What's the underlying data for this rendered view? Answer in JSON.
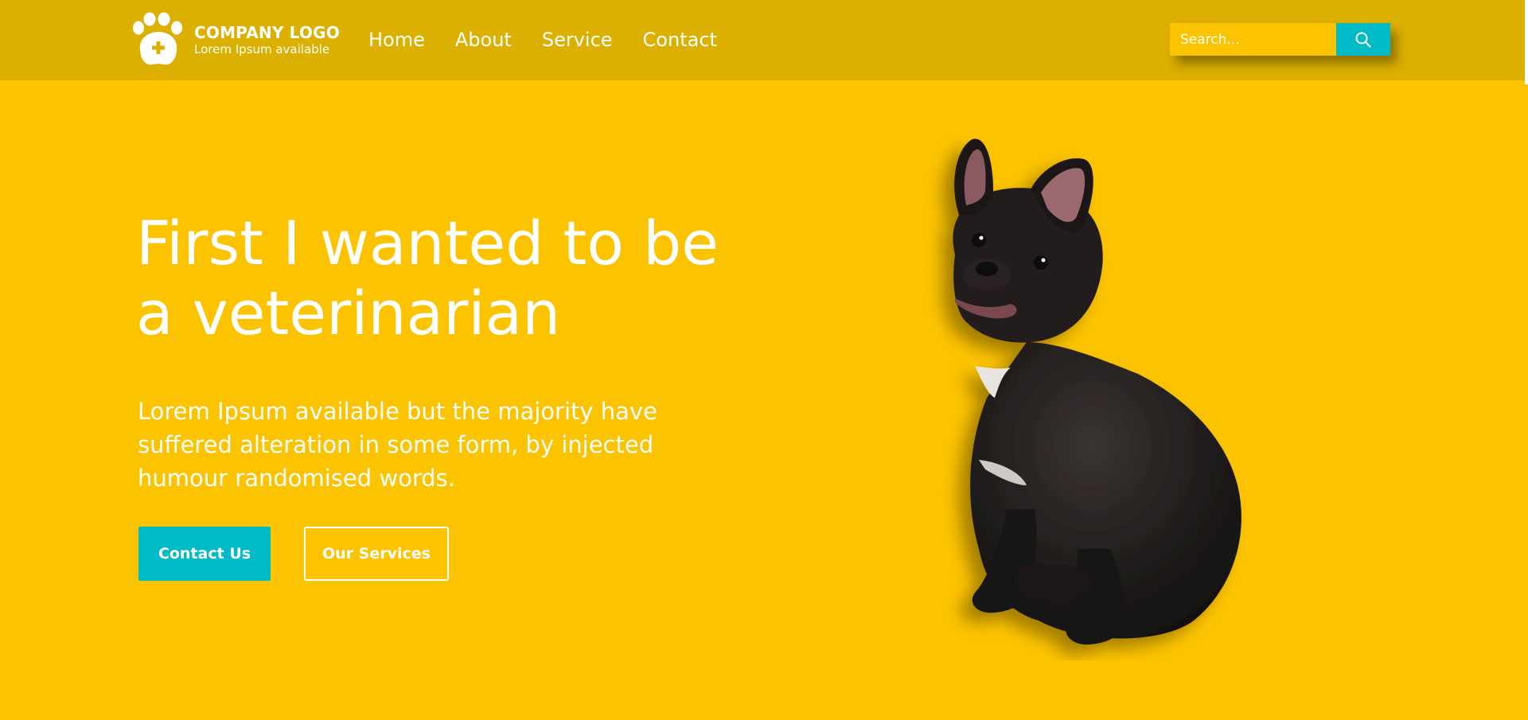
{
  "header": {
    "logo_title": "COMPANY LOGO",
    "logo_subtitle": "Lorem Ipsum available",
    "nav": [
      {
        "label": "Home"
      },
      {
        "label": "About"
      },
      {
        "label": "Service"
      },
      {
        "label": "Contact"
      }
    ],
    "search_placeholder": "Search...",
    "search_icon": "search-icon"
  },
  "hero": {
    "title_lines": [
      "First I wanted to be",
      "a veterinarian"
    ],
    "description_lines": [
      "Lorem Ipsum available but the majority have",
      "suffered alteration in some form, by injected",
      "humour randomised words."
    ],
    "primary_button": "Contact Us",
    "secondary_button": "Our Services",
    "image": "french-bulldog-image"
  },
  "colors": {
    "background": "#fcc300",
    "header": "#dcb000",
    "accent": "#00bac6",
    "text": "#ffffff"
  }
}
